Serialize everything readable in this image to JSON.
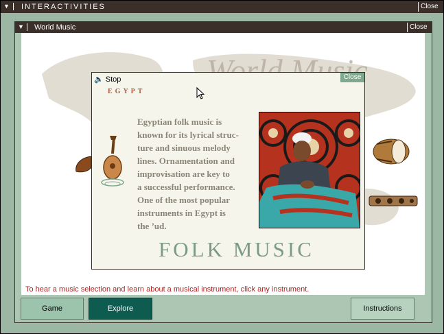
{
  "outer_window": {
    "title": "INTERACTIVITIES",
    "close_label": "Close",
    "menu_glyph": "▼"
  },
  "inner_window": {
    "title": "World Music",
    "close_label": "Close",
    "menu_glyph": "▼"
  },
  "map": {
    "title": "World Music"
  },
  "popup": {
    "stop_label": "Stop",
    "close_label": "Close",
    "country": "EGYPT",
    "description_lines": [
      "Egyptian folk music is",
      "known for its lyrical struc-",
      "ture and sinuous melody",
      "lines. Ornamentation and",
      "improvisation are key to",
      "a successful performance.",
      "One of the most popular",
      "instruments in Egypt is",
      "the ’ud."
    ],
    "heading": "FOLK MUSIC"
  },
  "hint": "To hear a music selection and learn about a musical instrument, click any instrument.",
  "buttons": {
    "game": "Game",
    "explore": "Explore",
    "instructions": "Instructions"
  },
  "colors": {
    "frame": "#9cb7a4",
    "title_bar": "#3b2f2a",
    "explore_active": "#0e5c4f",
    "hint_text": "#b02424",
    "heading": "#7c9b87"
  }
}
